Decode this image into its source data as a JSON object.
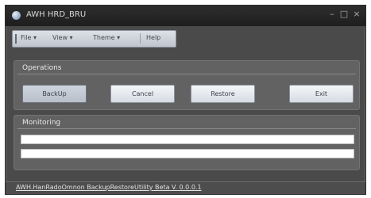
{
  "window": {
    "title": "AWH HRD_BRU",
    "controls": {
      "minimize": "–",
      "maximize": "□",
      "close": "×"
    }
  },
  "menubar": {
    "items": [
      {
        "label": "File"
      },
      {
        "label": "View"
      },
      {
        "label": "Theme"
      },
      {
        "label": "Help"
      }
    ],
    "dropdown_glyph": "▾"
  },
  "operations": {
    "title": "Operations",
    "buttons": {
      "backup": "BackUp",
      "cancel": "Cancel",
      "restore": "Restore",
      "exit": "Exit"
    }
  },
  "monitoring": {
    "title": "Monitoring",
    "progress": [
      0,
      0
    ]
  },
  "statusbar": {
    "text": "AWH.HanRadoOmnon BackupRestoreUtility Beta V. 0.0.0.1"
  },
  "colors": {
    "window_bg": "#4a4a4a",
    "panel_bg": "#626262",
    "titlebar_bg": "#262626",
    "accent": "#5a9be0"
  }
}
